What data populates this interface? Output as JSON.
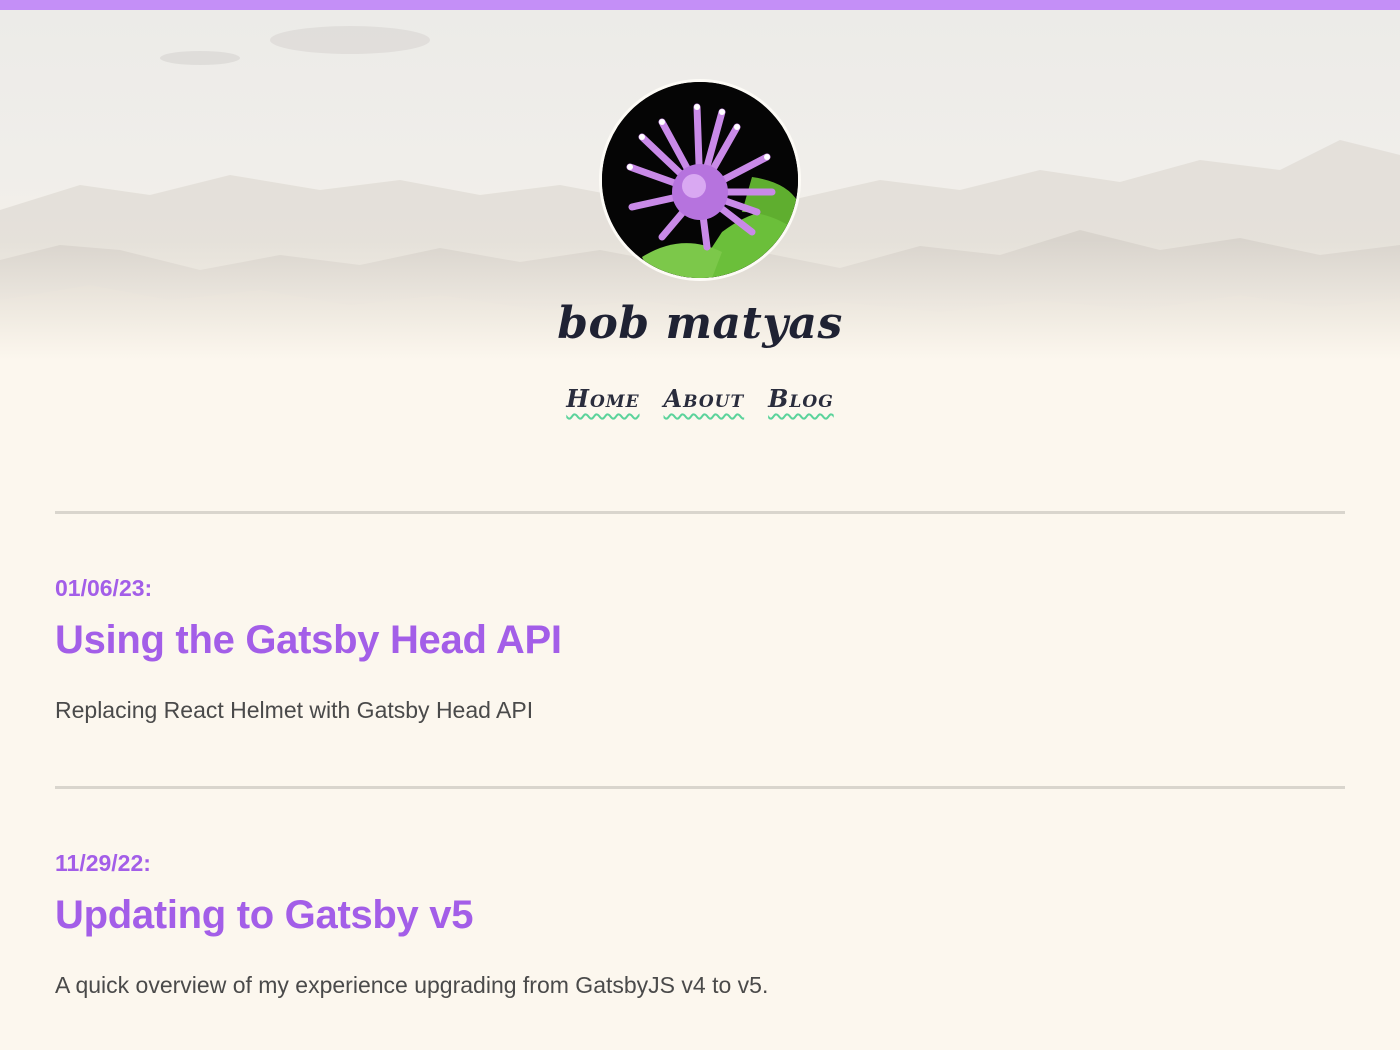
{
  "site": {
    "title": "bob matyas",
    "accent_color": "#c48ff7",
    "link_color": "#a35ee8",
    "underline_color": "#5bd39b"
  },
  "nav": {
    "items": [
      {
        "label": "Home"
      },
      {
        "label": "About"
      },
      {
        "label": "Blog"
      }
    ]
  },
  "posts": [
    {
      "date": "01/06/23:",
      "title": "Using the Gatsby Head API",
      "excerpt": "Replacing React Helmet with Gatsby Head API"
    },
    {
      "date": "11/29/22:",
      "title": "Updating to Gatsby v5",
      "excerpt": "A quick overview of my experience upgrading from GatsbyJS v4 to v5."
    }
  ],
  "icons": {
    "avatar": "bee-balm-flower-image"
  }
}
